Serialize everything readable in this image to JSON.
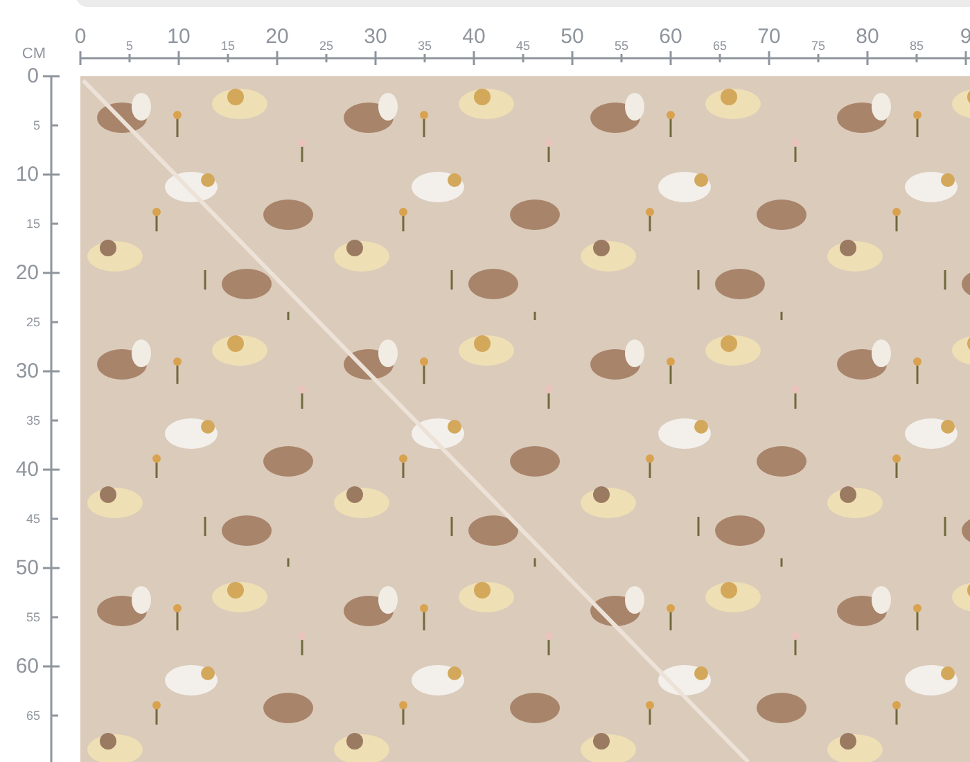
{
  "unit_label": "CM",
  "top_ruler": {
    "labels": [
      "0",
      "5",
      "10",
      "15",
      "20",
      "25",
      "30",
      "35",
      "40",
      "45",
      "50",
      "55",
      "60",
      "65",
      "70",
      "75",
      "80",
      "85",
      "9"
    ]
  },
  "left_ruler": {
    "labels": [
      "0",
      "5",
      "10",
      "15",
      "20",
      "25",
      "30",
      "35",
      "40",
      "45",
      "50",
      "55",
      "60",
      "65"
    ]
  }
}
